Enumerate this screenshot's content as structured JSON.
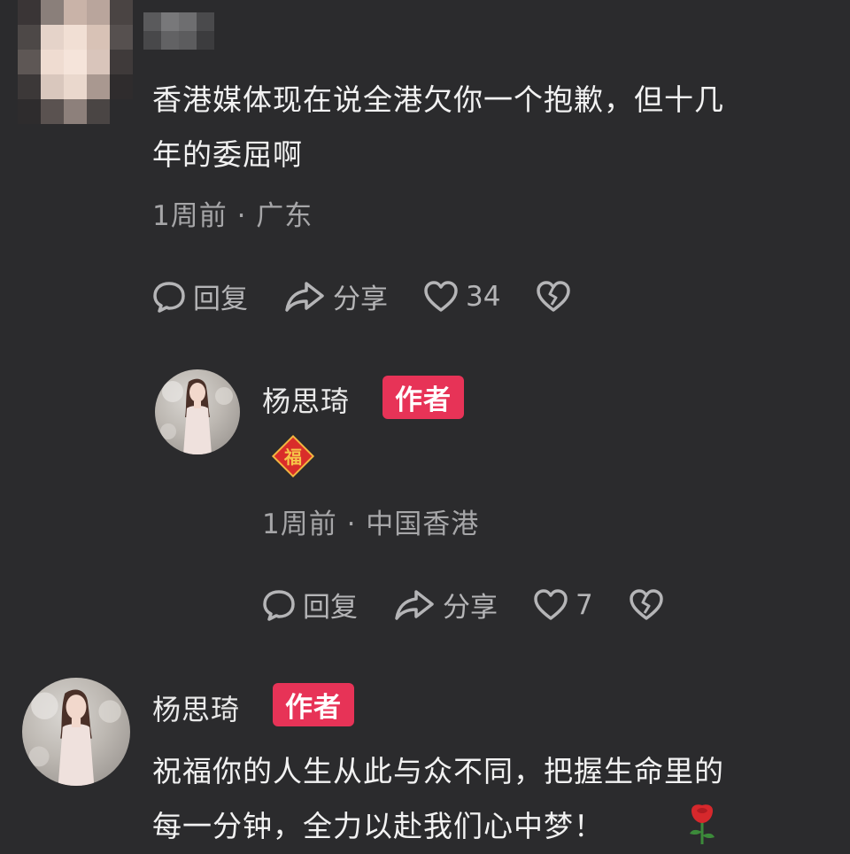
{
  "comments": [
    {
      "text_line1": "香港媒体现在说全港欠你一个抱歉，但十几",
      "text_line2": "年的委屈啊",
      "meta": "1周前 · 广东",
      "reply_label": "回复",
      "share_label": "分享",
      "likes": "34"
    }
  ],
  "reply": {
    "username": "杨思琦",
    "badge": "作者",
    "emoji_char": "福",
    "meta": "1周前 · 中国香港",
    "reply_label": "回复",
    "share_label": "分享",
    "likes": "7"
  },
  "comment2": {
    "username": "杨思琦",
    "badge": "作者",
    "text_line1": "祝福你的人生从此与众不同，把握生命里的",
    "text_line2": "每一分钟，全力以赴我们心中梦！"
  },
  "colors": {
    "background": "#2b2b2d",
    "badge": "#e73357",
    "meta_text": "#a6a6a8"
  },
  "icons": [
    "comment-icon",
    "share-icon",
    "heart-icon",
    "broken-heart-icon",
    "fu-sticker-icon",
    "rose-icon"
  ]
}
